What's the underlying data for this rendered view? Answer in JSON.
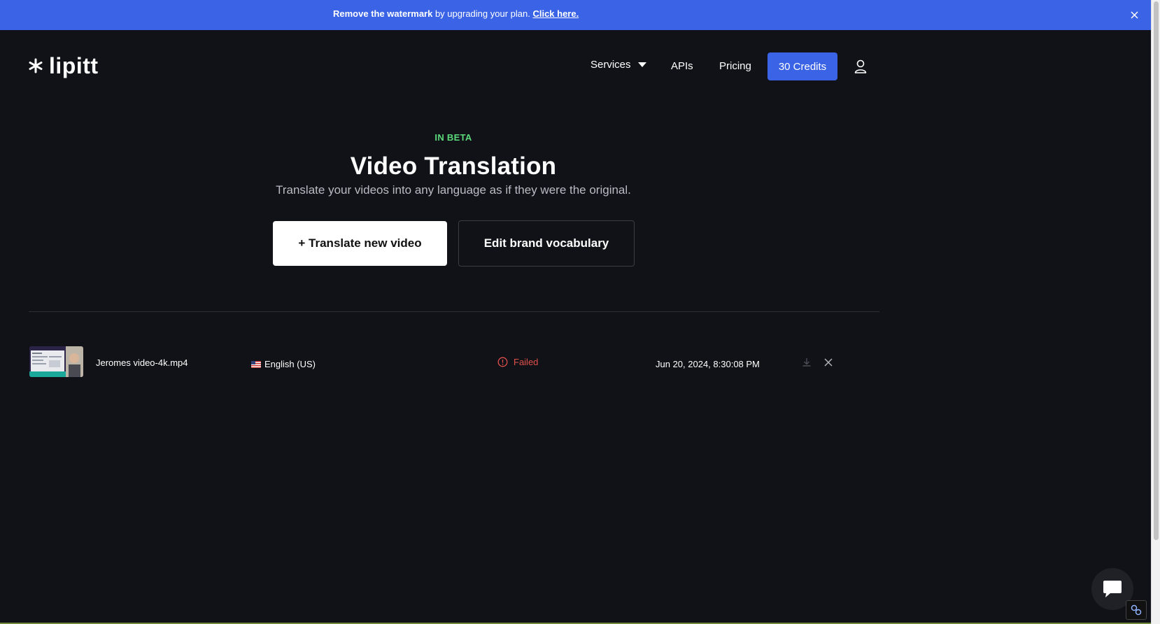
{
  "banner": {
    "bold_text": "Remove the watermark",
    "text": " by upgrading your plan. ",
    "link": "Click here."
  },
  "logo": {
    "text": "lipitt"
  },
  "nav": {
    "services": "Services",
    "apis": "APIs",
    "pricing": "Pricing",
    "credits": "30 Credits"
  },
  "hero": {
    "badge": "IN BETA",
    "title": "Video Translation",
    "subtitle": "Translate your videos into any language as if they were the original.",
    "translate_button": "+ Translate new video",
    "vocab_button": "Edit brand vocabulary"
  },
  "videos": [
    {
      "filename": "Jeromes video-4k.mp4",
      "language": "English (US)",
      "status": "Failed",
      "date": "Jun 20, 2024, 8:30:08 PM"
    }
  ],
  "colors": {
    "accent": "#3a63e6",
    "background": "#101217",
    "beta": "#5bd97a",
    "failed": "#e2504c"
  },
  "icons": [
    "close-icon",
    "logo-asterisk-icon",
    "chevron-down-icon",
    "user-icon",
    "alert-circle-icon",
    "download-icon",
    "delete-icon",
    "chat-icon"
  ]
}
